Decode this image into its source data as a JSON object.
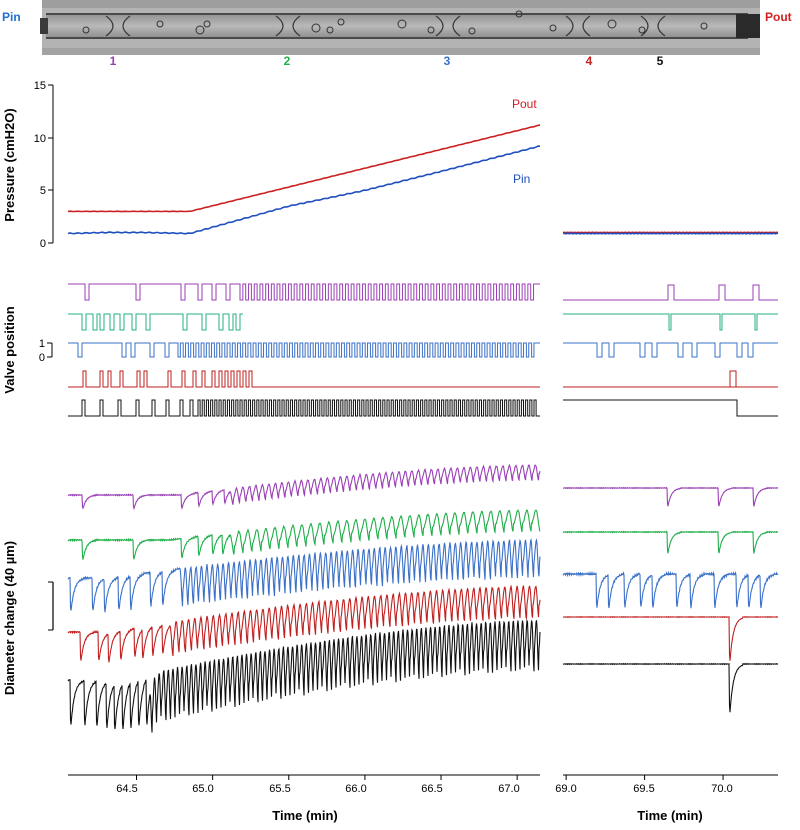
{
  "vessel": {
    "left_label": "Pin",
    "right_label": "Pout",
    "valve_numbers": [
      "1",
      "2",
      "3",
      "4",
      "5"
    ]
  },
  "colors": {
    "v1": "#9a3fb5",
    "v2": "#1fae4a",
    "v3": "#3a70c8",
    "v4": "#c01f1f",
    "v5": "#111111",
    "pout": "#cc1f1f",
    "pin": "#1f4fbf",
    "valve2": "#25b07e",
    "pin_label": "#1f6fd0",
    "pout_label": "#d42020"
  },
  "y_labels": {
    "pressure": "Pressure (cmH2O)",
    "valve": "Valve position",
    "diameter": "Diameter  change (40 µm)"
  },
  "pressure_ticks": [
    "0",
    "5",
    "10",
    "15"
  ],
  "valve_ticks": [
    "1",
    "0"
  ],
  "series_labels": {
    "pout": "Pout",
    "pin": "Pin"
  },
  "x_axis": {
    "label": "Time  (min)",
    "left_ticks": [
      "64.5",
      "65.0",
      "65.5",
      "66.0",
      "66.5",
      "67.0"
    ],
    "right_ticks": [
      "69.0",
      "69.5",
      "70.0"
    ]
  },
  "chart_data": {
    "type": "line",
    "pressure": {
      "ylabel": "Pressure (cmH2O)",
      "ylim": [
        0,
        15
      ],
      "xlim_left": [
        64.05,
        67.15
      ],
      "xlim_right": [
        68.98,
        70.35
      ],
      "series": [
        {
          "name": "Pout",
          "x": [
            64.05,
            64.85,
            67.15,
            68.98,
            70.35
          ],
          "values": [
            3.0,
            3.0,
            11.2,
            1.0,
            1.0
          ]
        },
        {
          "name": "Pin",
          "x": [
            64.05,
            64.3,
            64.55,
            64.85,
            65.5,
            66.0,
            66.5,
            67.15,
            68.98,
            70.35
          ],
          "values": [
            0.9,
            1.0,
            1.0,
            0.9,
            3.5,
            5.0,
            6.8,
            9.2,
            0.9,
            0.9
          ]
        }
      ]
    },
    "valve_position": {
      "ylabel": "Valve position",
      "ylim": [
        0,
        1
      ],
      "valves": [
        "1",
        "2",
        "3",
        "4",
        "5"
      ]
    },
    "diameter_change": {
      "ylabel": "Diameter  change (40 µm)",
      "scale_bar_um": 40,
      "valves": [
        "1",
        "2",
        "3",
        "4",
        "5"
      ]
    }
  }
}
